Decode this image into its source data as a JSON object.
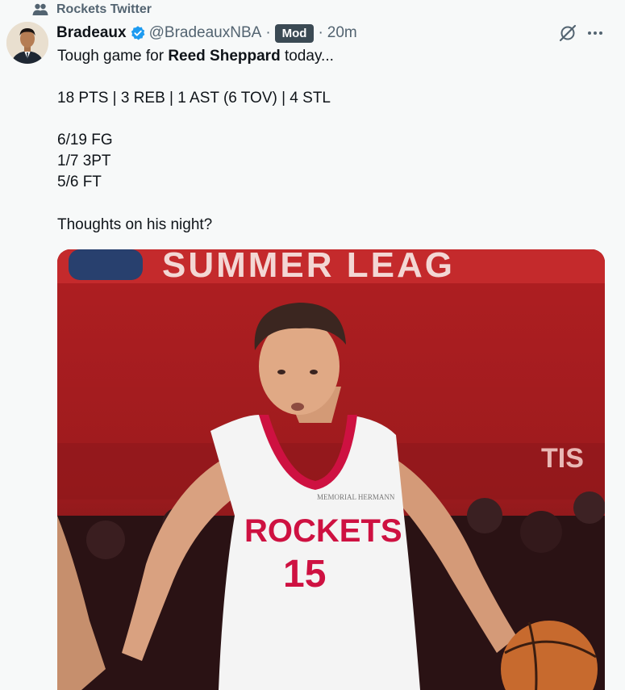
{
  "community": {
    "name": "Rockets Twitter",
    "icon": "community-icon"
  },
  "tweet": {
    "author": {
      "name": "Bradeaux",
      "handle": "@BradeauxNBA",
      "verified_icon": "verified-badge-icon",
      "badge": "Mod",
      "time": "20m"
    },
    "body": {
      "line1_prefix": "Tough game for ",
      "line1_bold": "Reed Sheppard",
      "line1_suffix": " today...",
      "stat_line": "18 PTS | 3 REB | 1 AST (6 TOV) | 4 STL",
      "fg": "6/19 FG",
      "three_pt": "1/7 3PT",
      "ft": "5/6 FT",
      "question": "Thoughts on his night?"
    },
    "actions": {
      "grok_icon": "grok-icon",
      "more_icon": "more-options-icon"
    },
    "media": {
      "banner_text": "SUMMER LEAG",
      "jersey_team": "ROCKETS",
      "jersey_number": "15",
      "jersey_sponsor": "MEMORIAL HERMANN",
      "side_text": "TIS"
    }
  },
  "colors": {
    "rockets_red": "#ce1141",
    "badge_bg": "#3b4a54",
    "verified_blue": "#1d9bf0",
    "muted": "#536471"
  }
}
